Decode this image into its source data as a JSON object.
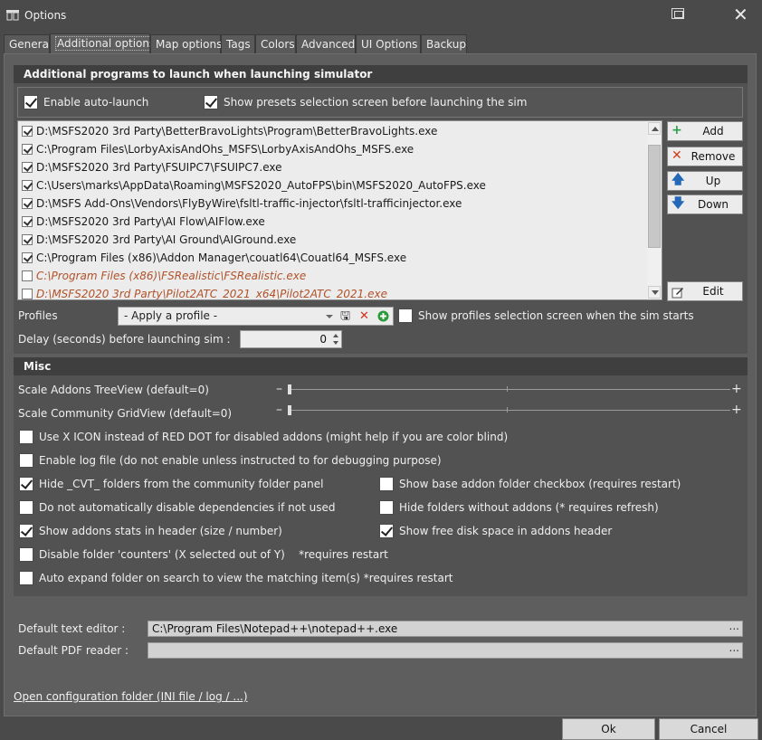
{
  "window": {
    "title": "Options"
  },
  "tabs": [
    "General",
    "Additional options",
    "Map options",
    "Tags",
    "Colors",
    "Advanced",
    "UI Options",
    "Backup"
  ],
  "launch": {
    "header": "Additional programs to launch when launching simulator",
    "enable_auto_launch": {
      "label": "Enable auto-launch",
      "checked": true
    },
    "show_presets": {
      "label": "Show presets selection screen before launching the sim",
      "checked": true
    },
    "programs": [
      {
        "path": "D:\\MSFS2020 3rd Party\\BetterBravoLights\\Program\\BetterBravoLights.exe",
        "checked": true
      },
      {
        "path": "C:\\Program Files\\LorbyAxisAndOhs_MSFS\\LorbyAxisAndOhs_MSFS.exe",
        "checked": true
      },
      {
        "path": "D:\\MSFS2020 3rd Party\\FSUIPC7\\FSUIPC7.exe",
        "checked": true
      },
      {
        "path": "C:\\Users\\marks\\AppData\\Roaming\\MSFS2020_AutoFPS\\bin\\MSFS2020_AutoFPS.exe",
        "checked": true
      },
      {
        "path": "D:\\MSFS Add-Ons\\Vendors\\FlyByWire\\fsltl-traffic-injector\\fsltl-trafficinjector.exe",
        "checked": true
      },
      {
        "path": "D:\\MSFS2020 3rd Party\\AI Flow\\AIFlow.exe",
        "checked": true
      },
      {
        "path": "D:\\MSFS2020 3rd Party\\AI Ground\\AIGround.exe",
        "checked": true
      },
      {
        "path": "C:\\Program Files (x86)\\Addon Manager\\couatl64\\Couatl64_MSFS.exe",
        "checked": true
      },
      {
        "path": "C:\\Program Files (x86)\\FSRealistic\\FSRealistic.exe",
        "checked": false
      },
      {
        "path": "D:\\MSFS2020 3rd Party\\Pilot2ATC_2021_x64\\Pilot2ATC_2021.exe",
        "checked": false
      }
    ],
    "buttons": {
      "add": "Add",
      "remove": "Remove",
      "up": "Up",
      "down": "Down",
      "edit": "Edit"
    },
    "profiles_label": "Profiles",
    "profile_value": "- Apply a profile -",
    "show_profiles": {
      "label": "Show profiles selection screen when the sim starts",
      "checked": false
    },
    "delay_label": "Delay (seconds) before launching sim :",
    "delay_value": "0"
  },
  "misc": {
    "header": "Misc",
    "scale_treeview_label": "Scale Addons TreeView (default=0)",
    "scale_gridview_label": "Scale Community GridView (default=0)",
    "scale_treeview_value": 0,
    "scale_gridview_value": 0,
    "opt_x_icon": {
      "label": "Use X ICON instead of RED DOT for disabled addons (might help if you are color blind)",
      "checked": false
    },
    "opt_log": {
      "label": "Enable log file (do not enable unless instructed to for debugging purpose)",
      "checked": false
    },
    "opt_hide_cvt": {
      "label": "Hide _CVT_ folders from the community folder panel",
      "checked": true
    },
    "opt_show_base": {
      "label": "Show base addon folder checkbox (requires restart)",
      "checked": false
    },
    "opt_no_disable_deps": {
      "label": "Do not automatically disable dependencies if not used",
      "checked": false
    },
    "opt_hide_no_addons": {
      "label": "Hide folders without addons (* requires refresh)",
      "checked": false
    },
    "opt_show_stats": {
      "label": "Show addons stats in header (size / number)",
      "checked": true
    },
    "opt_free_disk": {
      "label": "Show free disk space in addons header",
      "checked": true
    },
    "opt_disable_counters": {
      "label": "Disable folder 'counters' (X selected out of Y)    *requires restart",
      "checked": false
    },
    "opt_auto_expand": {
      "label": "Auto expand folder on search to view the matching item(s) *requires restart",
      "checked": false
    }
  },
  "editors": {
    "text_label": "Default text editor :",
    "text_value": "C:\\Program Files\\Notepad++\\notepad++.exe",
    "pdf_label": "Default PDF reader :",
    "pdf_value": "",
    "browse": "..."
  },
  "footer": {
    "config_link": "Open configuration folder (INI file / log / ...)",
    "ok": "Ok",
    "cancel": "Cancel"
  },
  "colors": {
    "accent_disabled_text": "#b0522a",
    "group_header": "#3f3f3f",
    "panel": "#5e5e5e"
  },
  "icons": [
    "app-icon",
    "restore-icon",
    "close-icon",
    "plus-icon",
    "x-icon",
    "arrow-up-icon",
    "arrow-down-icon",
    "edit-icon",
    "save-icon",
    "delete-icon",
    "add-circle-icon"
  ]
}
